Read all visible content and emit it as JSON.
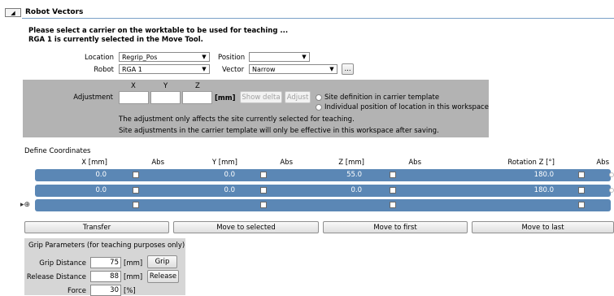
{
  "section": {
    "collapse_glyph": "◢",
    "title": "Robot Vectors"
  },
  "instructions": [
    "Please select a carrier on the worktable to be used for teaching ...",
    "RGA 1 is currently selected in the Move Tool."
  ],
  "selectors": {
    "location_label": "Location",
    "location_value": "Regrip_Pos",
    "position_label": "Position",
    "position_value": "",
    "robot_label": "Robot",
    "robot_value": "RGA 1",
    "vector_label": "Vector",
    "vector_value": "Narrow",
    "ellipsis_label": "..."
  },
  "adjustment": {
    "label": "Adjustment",
    "x_header": "X",
    "y_header": "Y",
    "z_header": "Z",
    "unit": "[mm]",
    "show_delta": "Show delta",
    "adjust": "Adjust",
    "radio_site_definition": "Site definition in carrier template",
    "radio_individual": "Individual position of location in this workspace",
    "note1": "The adjustment only affects the site currently selected for teaching.",
    "note2": "Site adjustments in the carrier template will only be effective in this workspace after saving."
  },
  "coordinates": {
    "title": "Define Coordinates",
    "headers": [
      "X [mm]",
      "Abs",
      "Y [mm]",
      "Abs",
      "Z [mm]",
      "Abs",
      "Rotation Z [°]",
      "Abs"
    ],
    "rows": [
      {
        "x": "0.0",
        "y": "0.0",
        "z": "55.0",
        "rot": "180.0"
      },
      {
        "x": "0.0",
        "y": "0.0",
        "z": "0.0",
        "rot": "180.0"
      },
      {
        "x": "",
        "y": "",
        "z": "",
        "rot": ""
      }
    ]
  },
  "actions": {
    "transfer": "Transfer",
    "move_selected": "Move to selected",
    "move_first": "Move to first",
    "move_last": "Move to last"
  },
  "grip": {
    "title": "Grip Parameters (for teaching purposes only)",
    "grip_distance_label": "Grip Distance",
    "grip_distance_value": "75",
    "release_distance_label": "Release Distance",
    "release_distance_value": "88",
    "force_label": "Force",
    "force_value": "30",
    "unit_mm": "[mm]",
    "unit_pct": "[%]",
    "grip_button": "Grip",
    "release_button": "Release"
  },
  "colors": {
    "row_blue": "#5b87b5",
    "panel_gray": "#b3b3b3",
    "grip_gray": "#d6d6d6"
  }
}
